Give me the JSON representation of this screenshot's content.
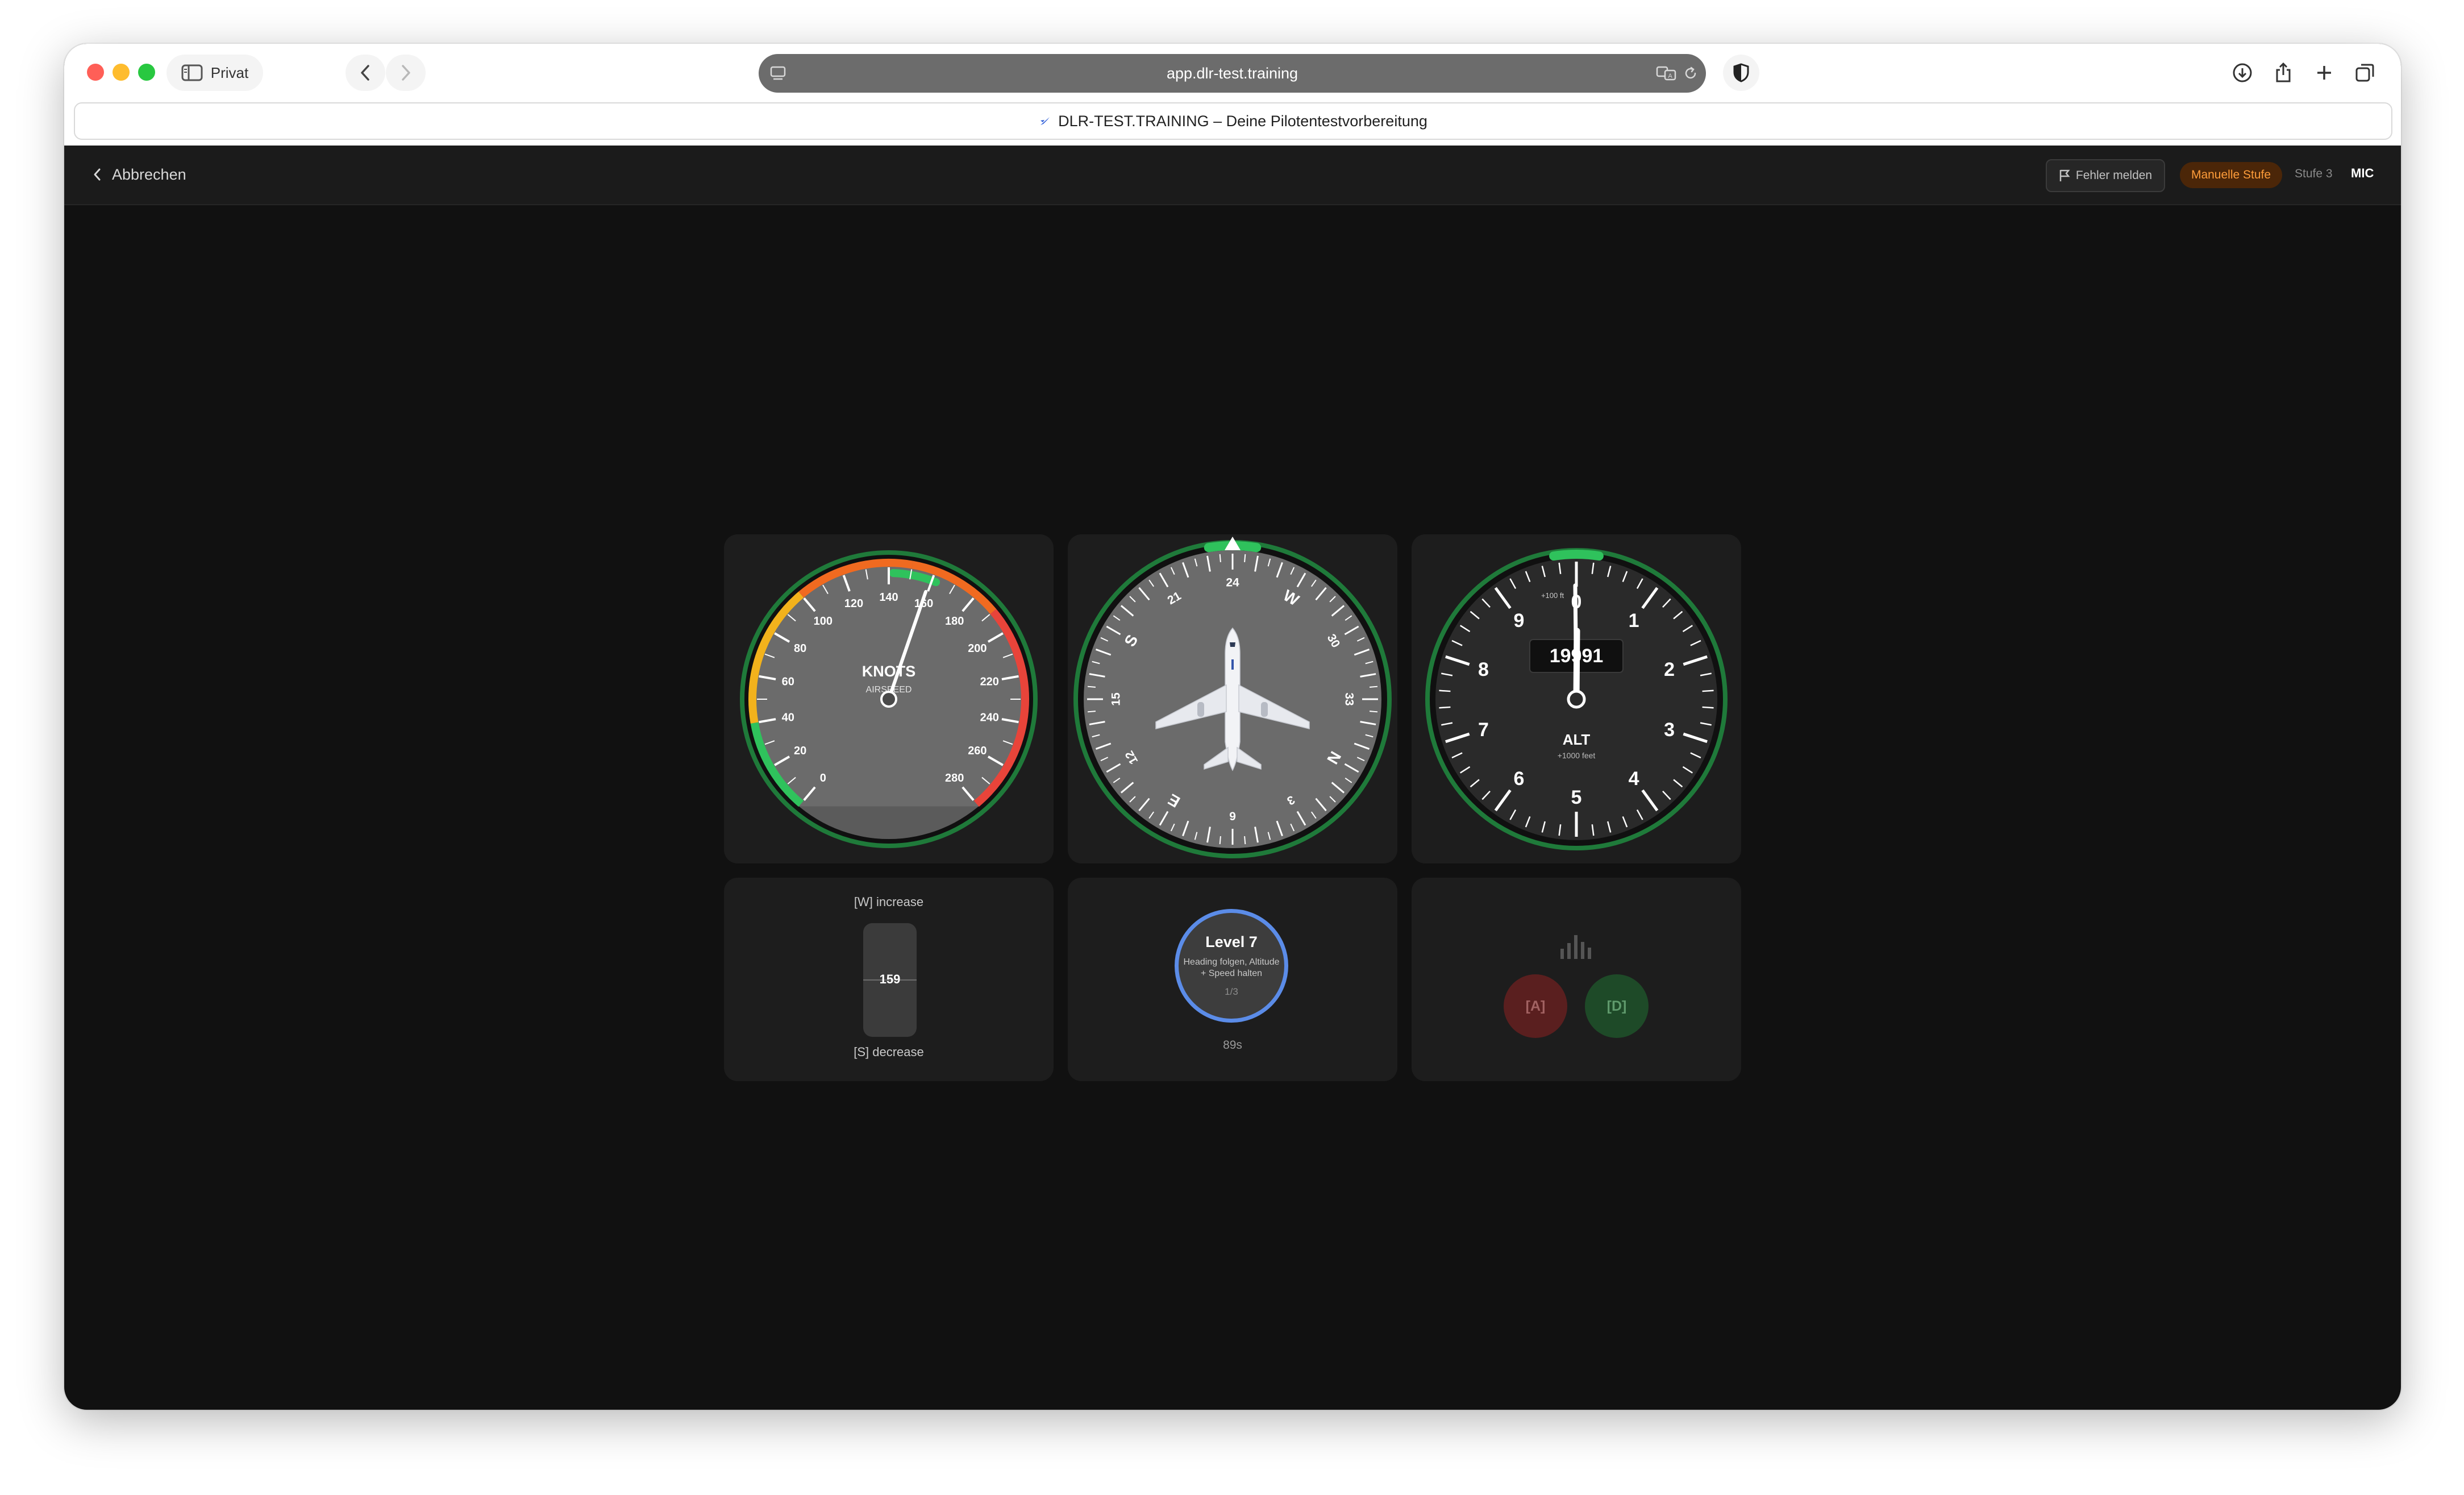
{
  "browser": {
    "sidebar_label": "Privat",
    "url": "app.dlr-test.training",
    "tab_title": "DLR-TEST.TRAINING – Deine Pilotentestvorbereitung"
  },
  "header": {
    "cancel_label": "Abbrechen",
    "report_label": "Fehler melden",
    "mode_label": "Manuelle Stufe",
    "stage_label": "Stufe 3",
    "mic_label": "MIC"
  },
  "airspeed": {
    "title": "KNOTS",
    "subtitle": "AIRSPEED",
    "ticks": [
      "0",
      "20",
      "40",
      "60",
      "80",
      "100",
      "120",
      "140",
      "160",
      "180",
      "200",
      "220",
      "240",
      "260",
      "280"
    ],
    "needle_value": 159,
    "target_value": 150
  },
  "heading": {
    "labels": [
      "N",
      "3",
      "6",
      "E",
      "12",
      "15",
      "S",
      "21",
      "24",
      "W",
      "30",
      "33"
    ],
    "heading_deg": 240
  },
  "altimeter": {
    "digits": [
      "0",
      "1",
      "2",
      "3",
      "4",
      "5",
      "6",
      "7",
      "8",
      "9"
    ],
    "readout": "19991",
    "top_label": "+100 ft",
    "title": "ALT",
    "subtitle": "+1000 feet"
  },
  "throttle": {
    "increase_label": "[W] increase",
    "decrease_label": "[S] decrease",
    "value": "159"
  },
  "level": {
    "title": "Level 7",
    "description": "Heading folgen, Altitude + Speed halten",
    "progress": "1/3",
    "timer": "89s"
  },
  "turn": {
    "left_key": "[A]",
    "right_key": "[D]"
  },
  "colors": {
    "gauge_ring": "#1f7a3a",
    "green": "#2fc25c",
    "yellow": "#f2b21c",
    "orange": "#f06a20",
    "red": "#e8443a",
    "level_ring": "#5b8ce8",
    "mode_badge_text": "#ff9d3a"
  }
}
